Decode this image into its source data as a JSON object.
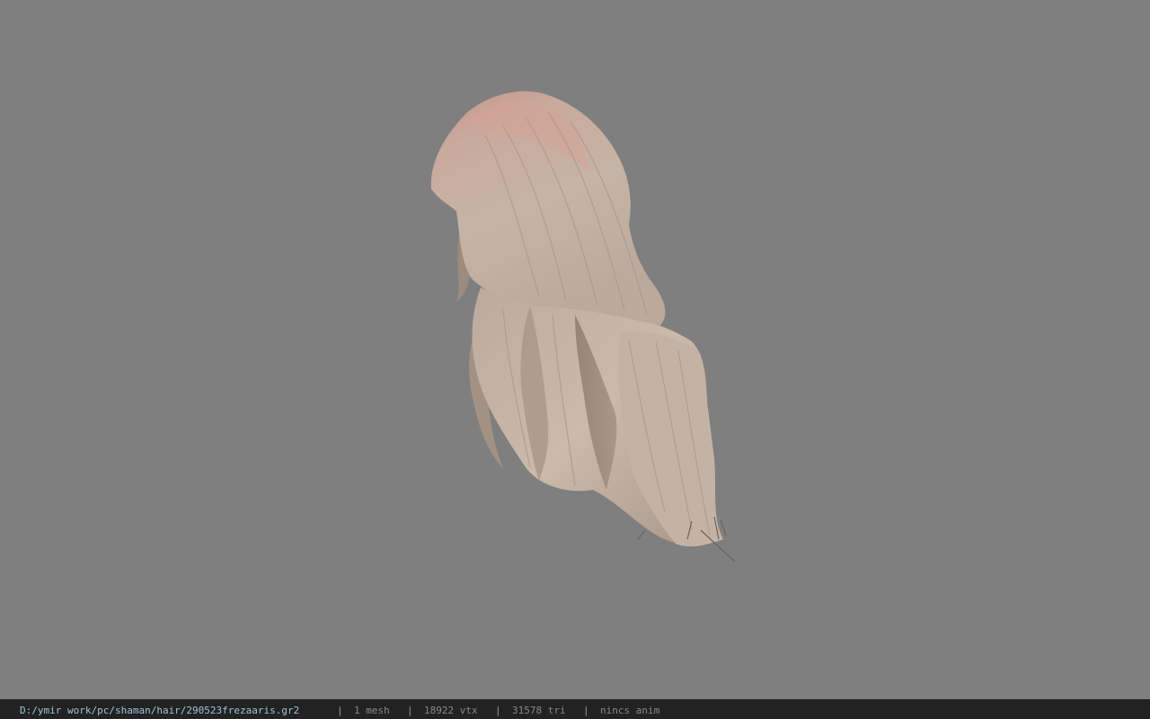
{
  "viewer": {
    "background_color": "#7f7f7f",
    "model": {
      "description_icon": "hair-mesh-model",
      "root_color": "#c9988a",
      "body_color": "#c8b5a6",
      "shadow_color": "#8e7e72"
    }
  },
  "status_bar": {
    "file_path": "D:/ymir work/pc/shaman/hair/290523frezaaris.gr2",
    "separator": "|",
    "mesh_count": "1 mesh",
    "vertex_count": "18922 vtx",
    "triangle_count": "31578 tri",
    "animation": "nincs anim",
    "path_color": "#9ec3d6",
    "text_color": "#8a8a8a",
    "bar_color": "#222222"
  }
}
